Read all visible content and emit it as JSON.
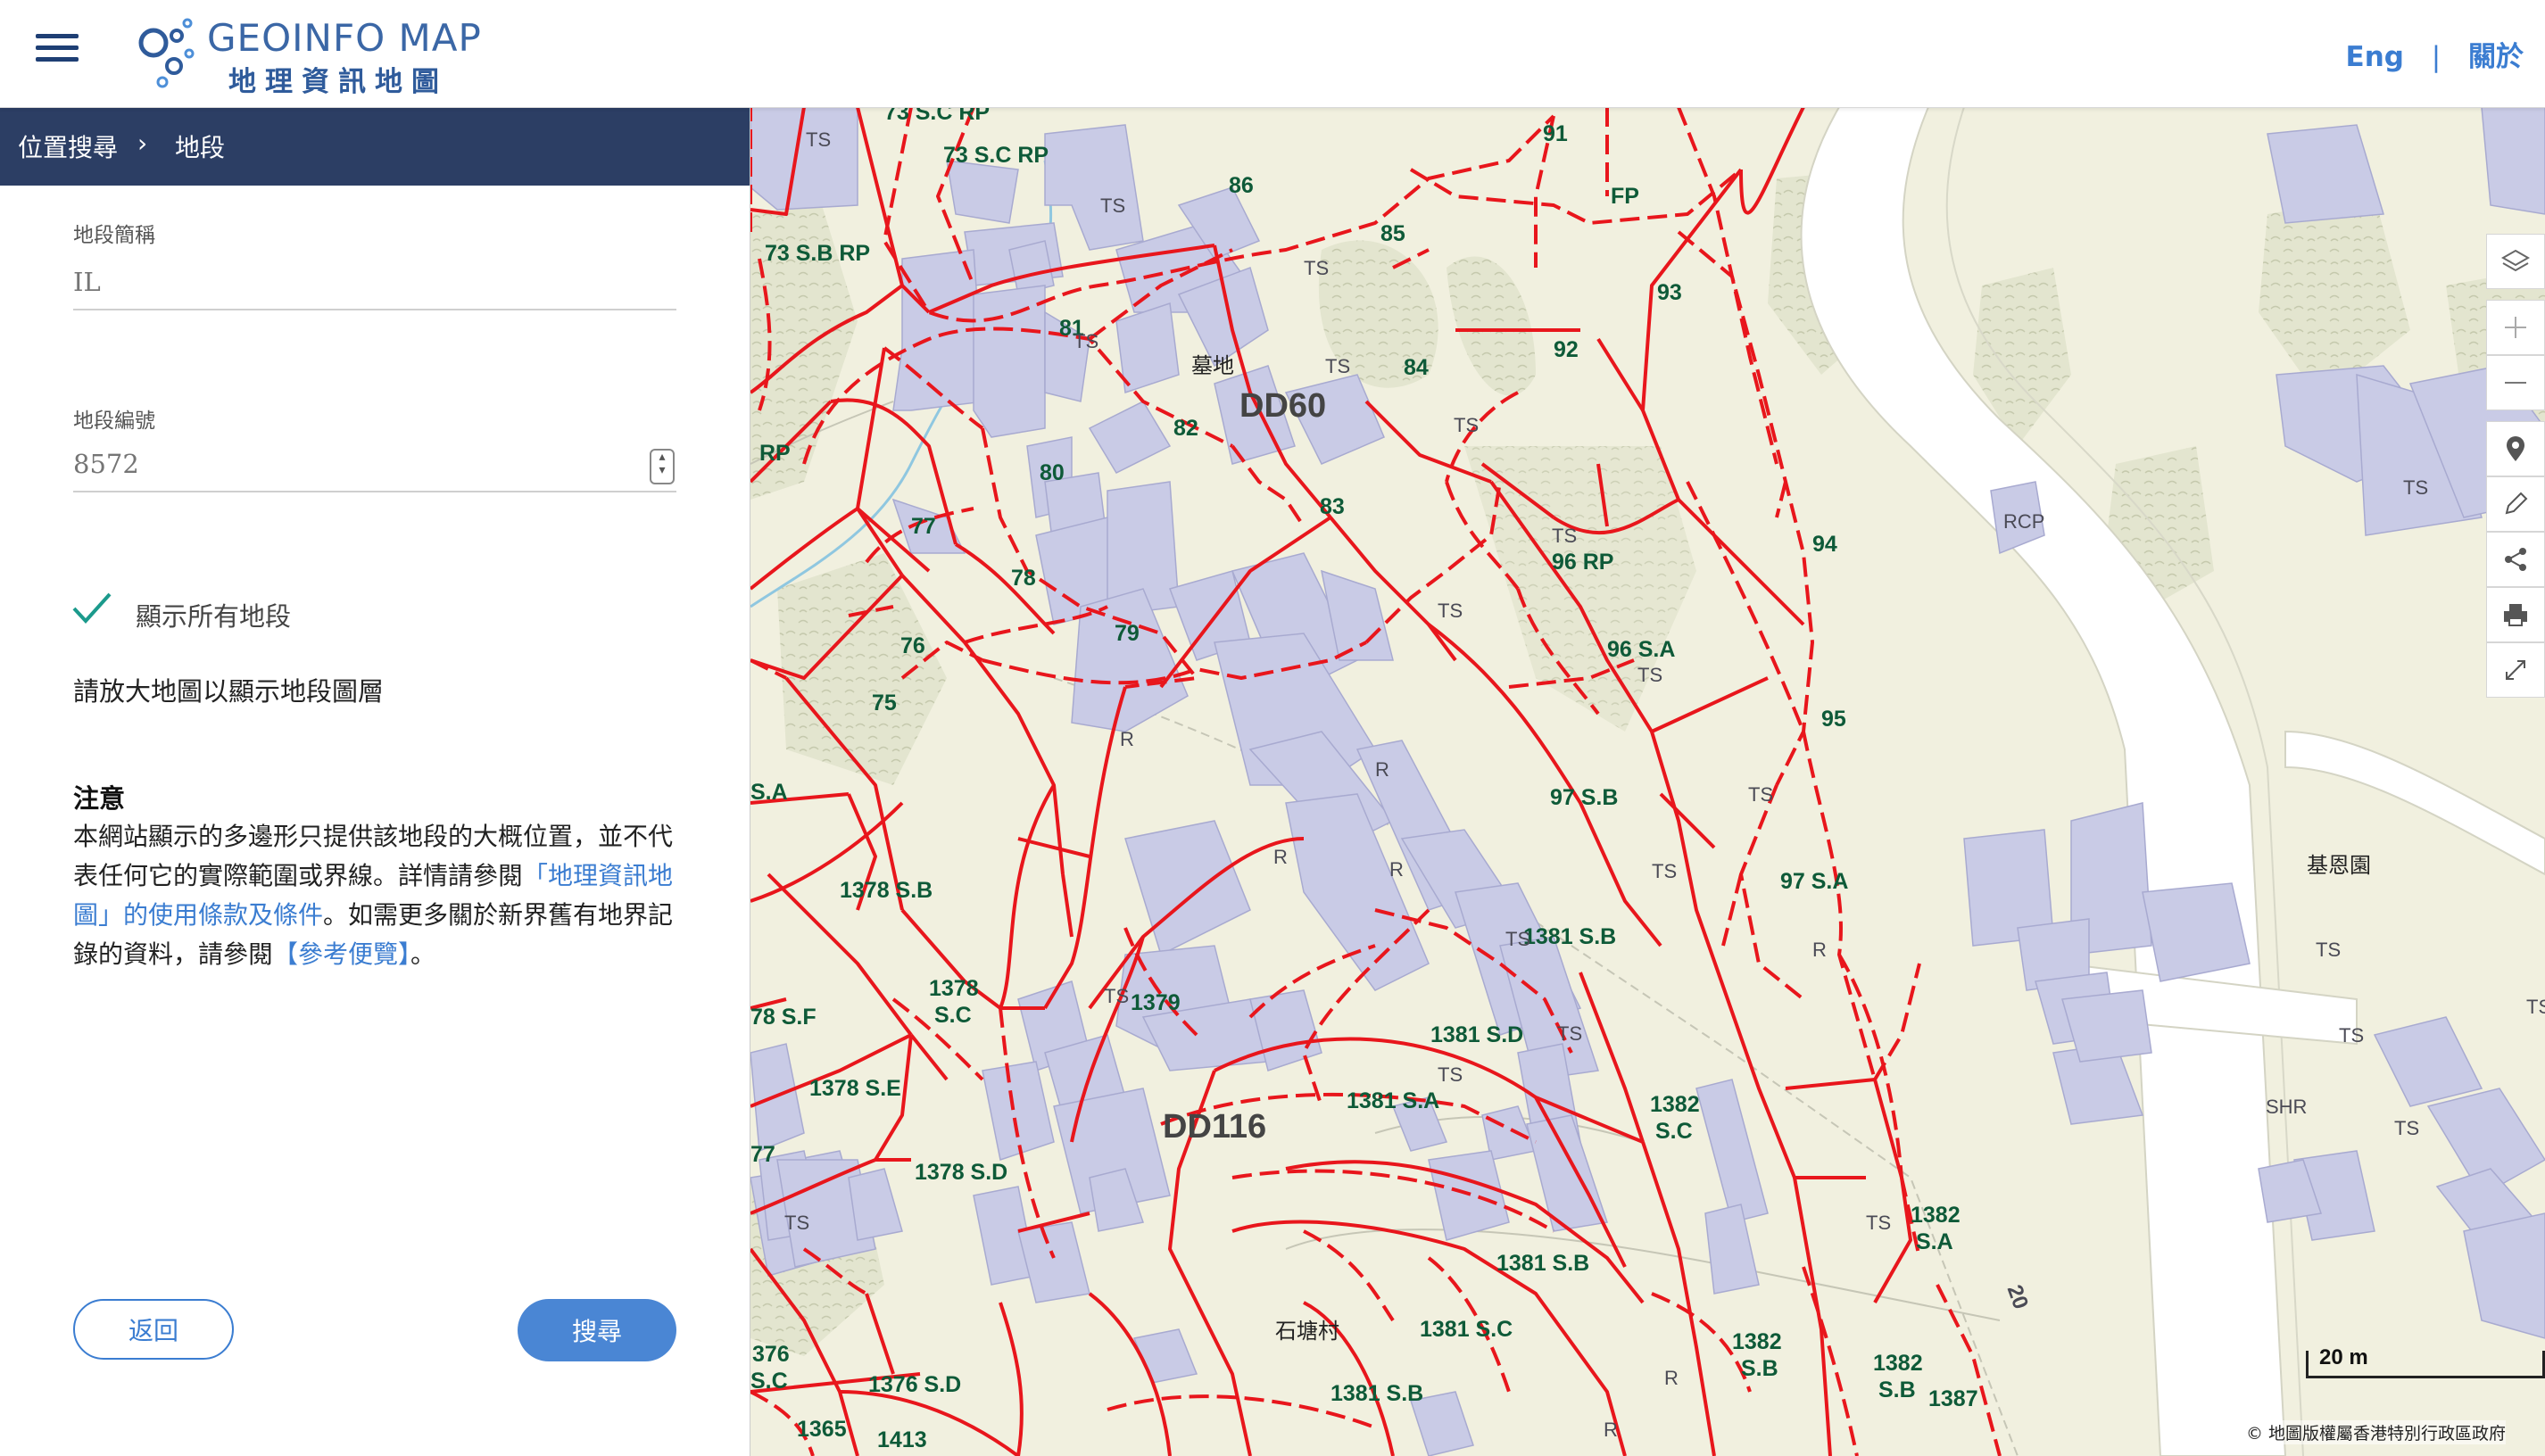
{
  "header": {
    "logo_en": "GEOINFO MAP",
    "logo_zh": "地理資訊地圖",
    "lang_label": "Eng",
    "separator": "|",
    "about_label": "關於"
  },
  "sidebar": {
    "breadcrumb": {
      "parent": "位置搜尋",
      "separator": "›",
      "current": "地段"
    },
    "lot_abbrev": {
      "label": "地段簡稱",
      "placeholder": "IL"
    },
    "lot_number": {
      "label": "地段編號",
      "placeholder": "8572"
    },
    "show_all_label": "顯示所有地段",
    "show_all_checked": true,
    "hint": "請放大地圖以顯示地段圖層",
    "notice": {
      "title": "注意",
      "text_before_link1": "本網站顯示的多邊形只提供該地段的大概位置，並不代表任何它的實際範圍或界線。詳情請參閱",
      "link1": "「地理資訊地圖」的使用條款及條件",
      "text_between": "。如需更多關於新界舊有地界記錄的資料，請參閱",
      "link2": "【參考便覽】",
      "text_after": "。"
    },
    "back_label": "返回",
    "search_label": "搜尋"
  },
  "map": {
    "districts": [
      "DD60",
      "DD116"
    ],
    "place_names": [
      "墓地",
      "石塘村",
      "基恩園"
    ],
    "lot_labels": [
      "73 S.C RP",
      "73 S.C RP",
      "73 S.B RP",
      "86",
      "85",
      "91",
      "FP",
      "93",
      "92",
      "81",
      "84",
      "82",
      "80",
      "RP",
      "77",
      "83",
      "78",
      "94",
      "79",
      "76",
      "96 RP",
      "96 S.A",
      "75",
      "95",
      "S.A",
      "97 S.B",
      "97 S.A",
      "1378 S.B",
      "1381 S.B",
      "1378",
      "S.C",
      "78 S.F",
      "1379",
      "1381 S.D",
      "1378 S.E",
      "1381 S.A",
      "1382",
      "S.C",
      "77",
      "1378 S.D",
      "1382",
      "S.A",
      "1381 S.B",
      "1381 S.C",
      "376",
      "S.C",
      "1376 S.D",
      "1382",
      "S.B",
      "1382",
      "S.B",
      "1381 S.B",
      "1365",
      "1413",
      "1387"
    ],
    "building_labels": [
      "TS",
      "R",
      "RCP",
      "SHR"
    ],
    "road_label": "20",
    "scale_label": "20 m",
    "copyright": "© 地圖版權屬香港特別行政區政府",
    "colors": {
      "lot_boundary": "#e8161c",
      "building": "#c9cbe6",
      "background": "#f1f0df",
      "road": "#ffffff",
      "label": "#0e5a38"
    }
  }
}
